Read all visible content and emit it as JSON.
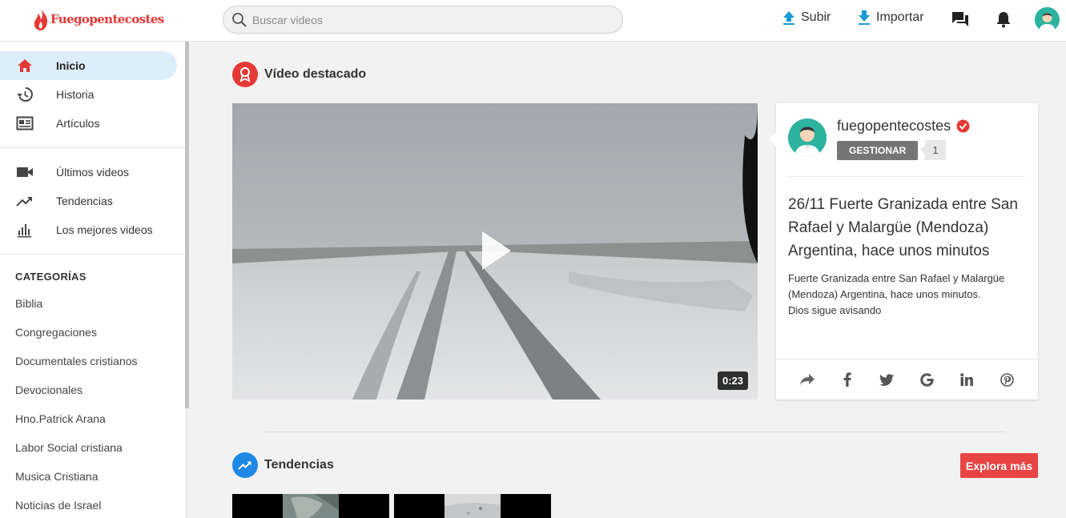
{
  "header": {
    "logo_text": "Fuegopentecostes",
    "search_placeholder": "Buscar videos",
    "upload_label": "Subir",
    "import_label": "Importar",
    "colors": {
      "accent": "#e53935",
      "upload": "#1a9ad6"
    }
  },
  "sidebar": {
    "items": [
      {
        "label": "Inicio",
        "icon": "home-icon",
        "active": true
      },
      {
        "label": "Historia",
        "icon": "history-icon"
      },
      {
        "label": "Artículos",
        "icon": "articles-icon"
      },
      {
        "label": "Últimos videos",
        "icon": "video-camera-icon"
      },
      {
        "label": "Tendencias",
        "icon": "trending-icon"
      },
      {
        "label": "Los mejores videos",
        "icon": "bar-chart-icon"
      }
    ],
    "categories_heading": "CATEGORÍAS",
    "categories": [
      "Biblia",
      "Congregaciones",
      "Documentales cristianos",
      "Devocionales",
      "Hno.Patrick Arana",
      "Labor Social cristiana",
      "Musica Cristiana",
      "Noticias de Israel"
    ]
  },
  "featured": {
    "section_title": "Vídeo destacado",
    "duration": "0:23",
    "channel_name": "fuegopentecostes",
    "manage_label": "GESTIONAR",
    "subscriber_count": "1",
    "title": "26/11 Fuerte Granizada entre San Rafael y Malargüe (Mendoza) Argentina, hace unos minutos",
    "description": "Fuerte Granizada entre San Rafael y Malargüe (Mendoza) Argentina, hace unos minutos.\nDios sigue avisando",
    "share_icons": [
      "share-icon",
      "facebook-icon",
      "twitter-icon",
      "google-icon",
      "linkedin-icon",
      "pinterest-icon"
    ]
  },
  "trending": {
    "section_title": "Tendencias",
    "explore_label": "Explora más",
    "colors": {
      "icon": "#1e88e5",
      "explore": "#e94444"
    }
  }
}
